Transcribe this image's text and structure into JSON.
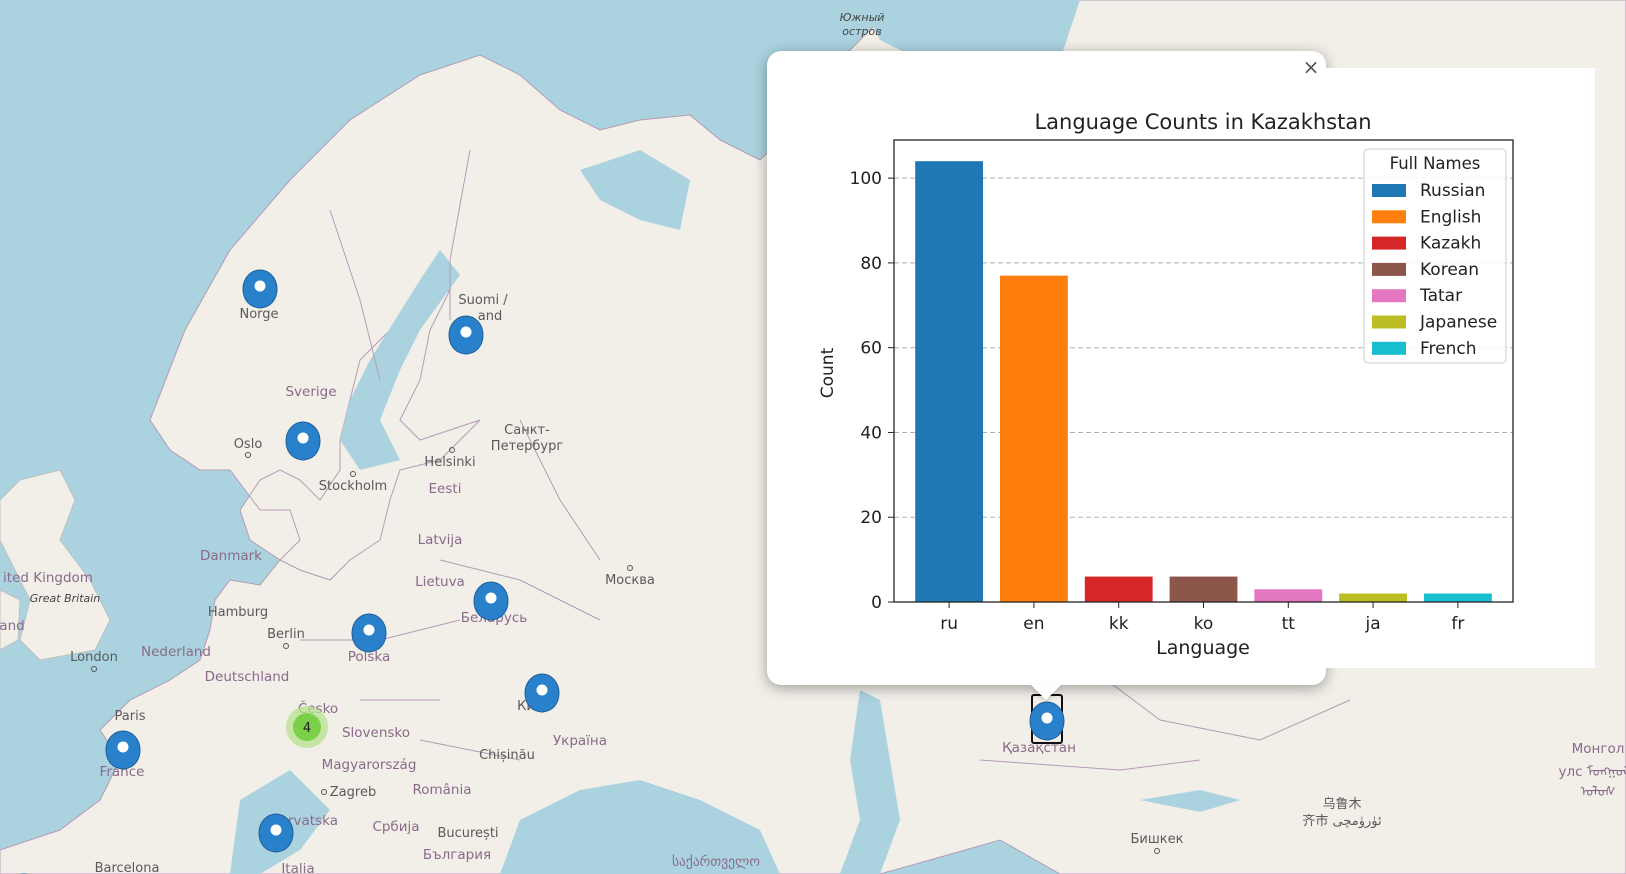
{
  "map": {
    "labels": {
      "yuzhny_ostrov_1": "Южный",
      "yuzhny_ostrov_2": "остров",
      "norge": "Norge",
      "suomi": "Suomi /",
      "finland_tail": "and",
      "sverige": "Sverige",
      "oslo": "Oslo",
      "stockholm": "Stockholm",
      "helsinki": "Helsinki",
      "spb_1": "Санкт-",
      "spb_2": "Петербург",
      "eesti": "Eesti",
      "latvija": "Latvija",
      "danmark": "Danmark",
      "lietuva": "Lietuva",
      "moskva": "Москва",
      "united_kingdom": "ited Kingdom",
      "great_britain": "Great Britain",
      "hamburg": "Hamburg",
      "berlin": "Berlin",
      "belarus": "Беларусь",
      "ireland_tail": "and",
      "london": "London",
      "nederland": "Nederland",
      "polska": "Polska",
      "deutschland": "Deutschland",
      "kyiv": "Ки",
      "paris": "Paris",
      "cesko": "Česko",
      "slovensko": "Slovensko",
      "ukraina": "Україна",
      "france": "France",
      "magyarorszag": "Magyarország",
      "chisinau": "Chișinău",
      "zagreb": "Zagreb",
      "romania": "România",
      "hrvatska": "rvatska",
      "srbija": "Србија",
      "bucuresti": "București",
      "bulgaria": "България",
      "barcelona": "Barcelona",
      "italia": "Italia",
      "georgia": "საქართველო",
      "kazakhstan": "Қазақстан",
      "urumqi_1": "乌鲁木",
      "urumqi_2": "齐市 ئۈرۈمچى",
      "bishkek": "Бишкек",
      "mongolia_1": "Монгол",
      "mongolia_2": "улс ᠮᠣᠩᠭᠣᠯ",
      "mongolia_3": "ᠤᠯᠤᠰ"
    },
    "cluster": {
      "count": "4"
    },
    "colors": {
      "water": "#aad3df",
      "land": "#f2efe9",
      "marker": "#2a81cb",
      "cluster_outer": "#b5e28c",
      "cluster_inner": "#6ecc39",
      "border": "#b59bb5"
    }
  },
  "popup": {
    "close_glyph": "×"
  },
  "chart_data": {
    "type": "bar",
    "title": "Language Counts in Kazakhstan",
    "xlabel": "Language",
    "ylabel": "Count",
    "categories": [
      "ru",
      "en",
      "kk",
      "ko",
      "tt",
      "ja",
      "fr"
    ],
    "values": [
      104,
      77,
      6,
      6,
      3,
      2,
      2
    ],
    "colors": [
      "#1f77b4",
      "#ff7f0e",
      "#d62728",
      "#8c564b",
      "#e377c2",
      "#bcbd22",
      "#17becf"
    ],
    "ylim": [
      0,
      109
    ],
    "yticks": [
      0,
      20,
      40,
      60,
      80,
      100
    ],
    "grid": "y-dashed",
    "legend": {
      "title": "Full Names",
      "position": "top-right",
      "entries": [
        "Russian",
        "English",
        "Kazakh",
        "Korean",
        "Tatar",
        "Japanese",
        "French"
      ]
    }
  }
}
